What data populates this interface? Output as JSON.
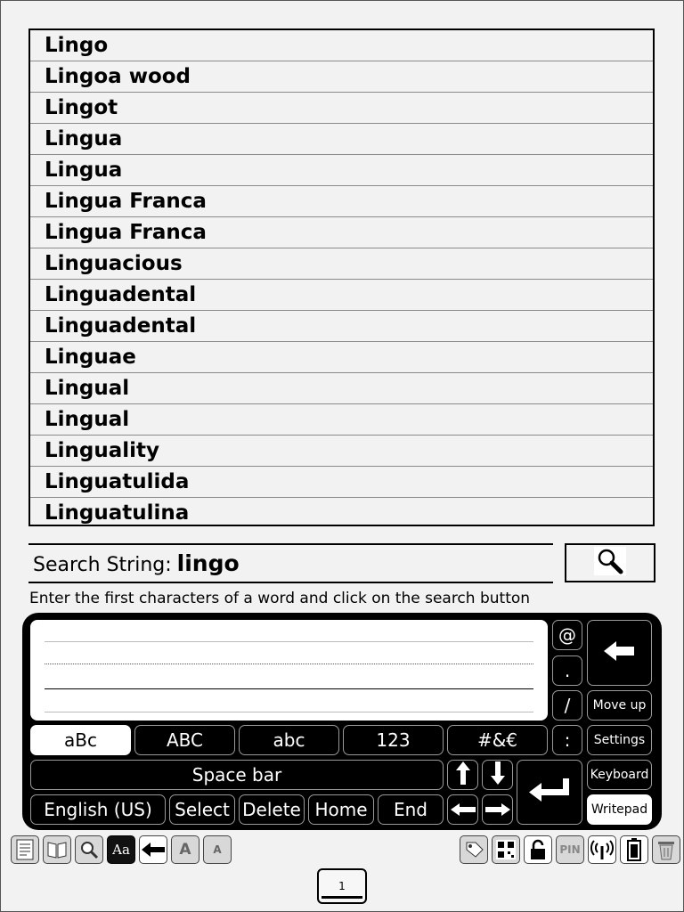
{
  "word_list": [
    "Lingo",
    "Lingoa wood",
    "Lingot",
    "Lingua",
    "Lingua",
    "Lingua Franca",
    "Lingua Franca",
    "Linguacious",
    "Linguadental",
    "Linguadental",
    "Linguae",
    "Lingual",
    "Lingual",
    "Linguality",
    "Linguatulida",
    "Linguatulina"
  ],
  "search": {
    "label": "Search String:",
    "value": "lingo",
    "hint": "Enter the first characters of a word and click on the search button"
  },
  "keyboard": {
    "symbols": {
      "at": "@",
      "dot": ".",
      "slash": "/",
      "colon": ":"
    },
    "modes": {
      "mixed": "aBc",
      "upper": "ABC",
      "lower": "abc",
      "numbers": "123",
      "special": "#&€"
    },
    "space": "Space bar",
    "language": "English (US)",
    "select": "Select",
    "delete": "Delete",
    "home": "Home",
    "end": "End",
    "move_up": "Move up",
    "settings": "Settings",
    "keyboard": "Keyboard",
    "writepad": "Writepad"
  },
  "toolbar": {
    "left_icons": [
      "toc-icon",
      "book-icon",
      "search-icon",
      "font-icon",
      "back-icon",
      "zoom-in-icon",
      "zoom-out-icon"
    ],
    "right_icons": [
      "tag-icon",
      "qr-code-icon",
      "lock-icon",
      "pin-icon",
      "wireless-icon",
      "battery-icon",
      "trash-icon"
    ],
    "font_label": "Aa",
    "pin_label": "PIN"
  },
  "page": {
    "number": "1"
  }
}
